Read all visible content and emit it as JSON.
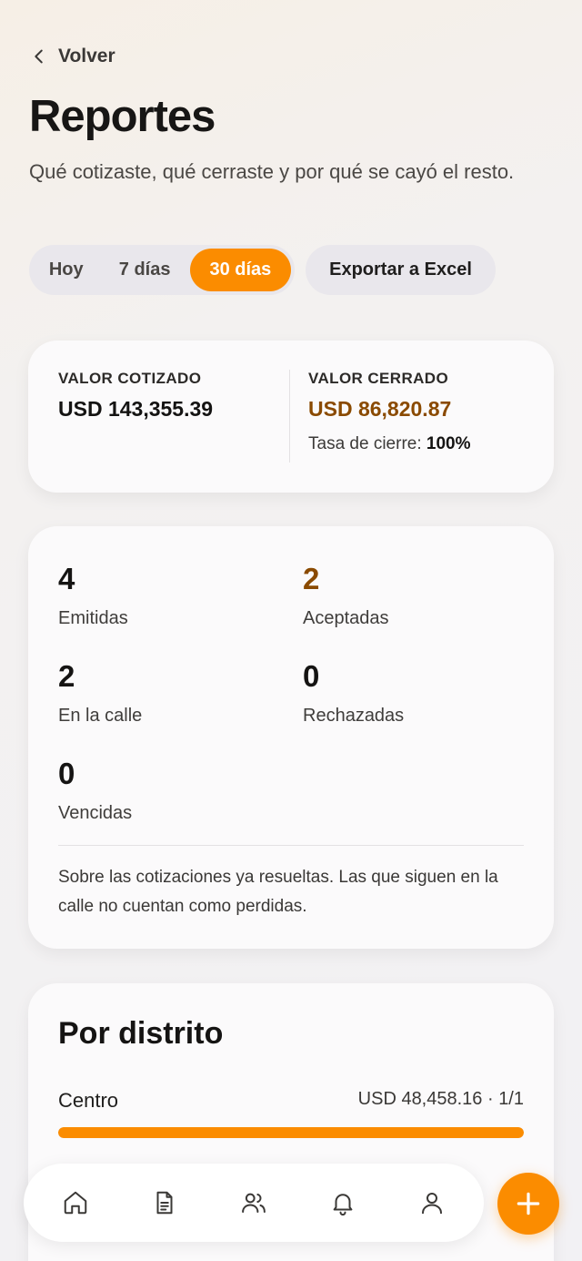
{
  "header": {
    "back_label": "Volver",
    "title": "Reportes",
    "subtitle": "Qué cotizaste, qué cerraste y por qué se cayó el resto."
  },
  "period_tabs": [
    {
      "label": "Hoy",
      "active": false
    },
    {
      "label": "7 días",
      "active": false
    },
    {
      "label": "30 días",
      "active": true
    }
  ],
  "export_label": "Exportar a Excel",
  "summary": {
    "quoted_label": "VALOR COTIZADO",
    "quoted_value": "USD 143,355.39",
    "closed_label": "VALOR CERRADO",
    "closed_value": "USD 86,820.87",
    "close_rate_label": "Tasa de cierre:",
    "close_rate_value": "100%"
  },
  "stats": {
    "emitted": {
      "value": "4",
      "label": "Emitidas"
    },
    "accepted": {
      "value": "2",
      "label": "Aceptadas"
    },
    "in_street": {
      "value": "2",
      "label": "En la calle"
    },
    "rejected": {
      "value": "0",
      "label": "Rechazadas"
    },
    "expired": {
      "value": "0",
      "label": "Vencidas"
    },
    "note": "Sobre las cotizaciones ya resueltas. Las que siguen en la calle no cuentan como perdidas."
  },
  "districts": {
    "title": "Por distrito",
    "rows": [
      {
        "name": "Centro",
        "value": "USD 48,458.16 · 1/1",
        "fill": 1.0
      }
    ]
  },
  "nav": {
    "items": [
      "home-icon",
      "document-icon",
      "users-icon",
      "bell-icon",
      "profile-icon"
    ]
  },
  "colors": {
    "accent": "#fb8c00",
    "accent_text": "#8a4a00"
  }
}
